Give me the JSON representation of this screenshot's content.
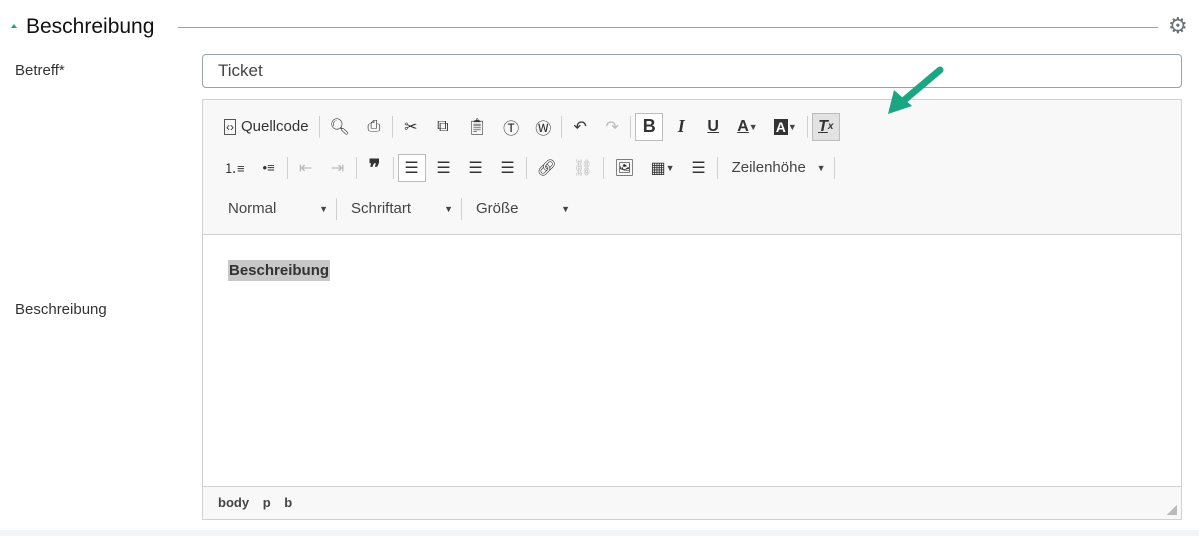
{
  "section": {
    "title": "Beschreibung",
    "settings_icon": "gear-icon"
  },
  "fields": {
    "subject": {
      "label": "Betreff*",
      "value": "Ticket"
    },
    "description": {
      "label": "Beschreibung"
    }
  },
  "toolbar": {
    "source_label": "Quellcode",
    "format": "Normal",
    "font": "Schriftart",
    "size": "Größe",
    "line_height": "Zeilenhöhe"
  },
  "editor": {
    "content": "Beschreibung",
    "path": [
      "body",
      "p",
      "b"
    ]
  },
  "colors": {
    "accent": "#1aa683",
    "border": "#d1d1d1"
  }
}
